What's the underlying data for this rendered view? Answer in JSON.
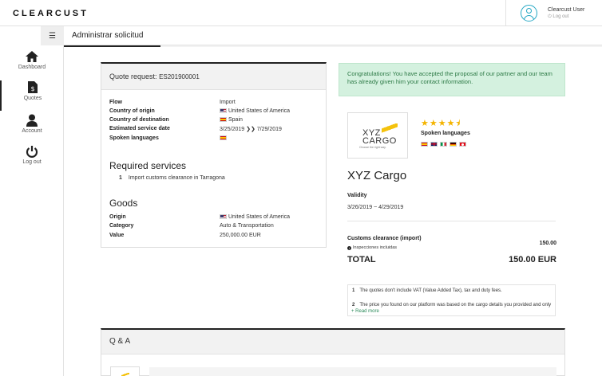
{
  "app": {
    "logo": "CLEARCUST"
  },
  "user": {
    "name": "Clearcust User",
    "logout": "⏻ Log out"
  },
  "sidebar": {
    "items": [
      {
        "label": "Dashboard",
        "icon": "home-icon"
      },
      {
        "label": "Quotes",
        "icon": "invoice-dollar-icon",
        "active": true
      },
      {
        "label": "Account",
        "icon": "user-icon"
      },
      {
        "label": "Log out",
        "icon": "power-icon"
      }
    ]
  },
  "page": {
    "title": "Administrar solicitud"
  },
  "quote": {
    "header_label": "Quote request:",
    "number": "ES201900001",
    "fields": [
      {
        "key": "Flow",
        "value": "Import"
      },
      {
        "key": "Country of origin",
        "value": "United States of America",
        "flag": "us"
      },
      {
        "key": "Country of destination",
        "value": "Spain",
        "flag": "es"
      },
      {
        "key": "Estimated service date",
        "value": "3/25/2019 ❯❯ 7/29/2019"
      },
      {
        "key": "Spoken languages",
        "value": "",
        "flag": "es"
      }
    ],
    "required_services_title": "Required services",
    "services": [
      {
        "num": "1",
        "label": "Import customs clearance in Tarragona"
      }
    ],
    "goods_title": "Goods",
    "goods": [
      {
        "key": "Origin",
        "value": "United States of America",
        "flag": "us"
      },
      {
        "key": "Category",
        "value": "Auto & Transportation"
      },
      {
        "key": "Value",
        "value": "250,000.00 EUR"
      }
    ]
  },
  "alert": {
    "text": "Congratulations! You have accepted the proposal of our partner and our team has already given him your contact information."
  },
  "proposal": {
    "logo_text_line1": "XYZ",
    "logo_text_line2": "CARGO",
    "logo_tagline": "Choose the right way.",
    "rating": 4.5,
    "stars": "★★★★⯨",
    "spoken_label": "Spoken languages",
    "spoken_flags": [
      "es",
      "gb",
      "it",
      "de",
      "tr"
    ],
    "name": "XYZ Cargo",
    "validity_label": "Validity",
    "validity": "3/26/2019 ~ 4/29/2019",
    "clearance_label": "Customs clearance (import)",
    "clearance_value": "150.00",
    "inspections": "Inspecciones incluidas",
    "total_label": "TOTAL",
    "total_value": "150.00 EUR",
    "notes": [
      {
        "num": "1",
        "text": "The quotes don't include VAT (Value Added Tax), tax and duty fees."
      },
      {
        "num": "2",
        "text": "The price you found on our platform was based on the cargo details you provided and only"
      }
    ],
    "read_more": "+ Read more"
  },
  "qa": {
    "title": "Q & A"
  },
  "colors": {
    "accent": "#24a7c4",
    "success_bg": "#d4f1df",
    "success_text": "#2d7a46",
    "star": "#f4b400",
    "logo_yellow": "#f4c20d"
  }
}
